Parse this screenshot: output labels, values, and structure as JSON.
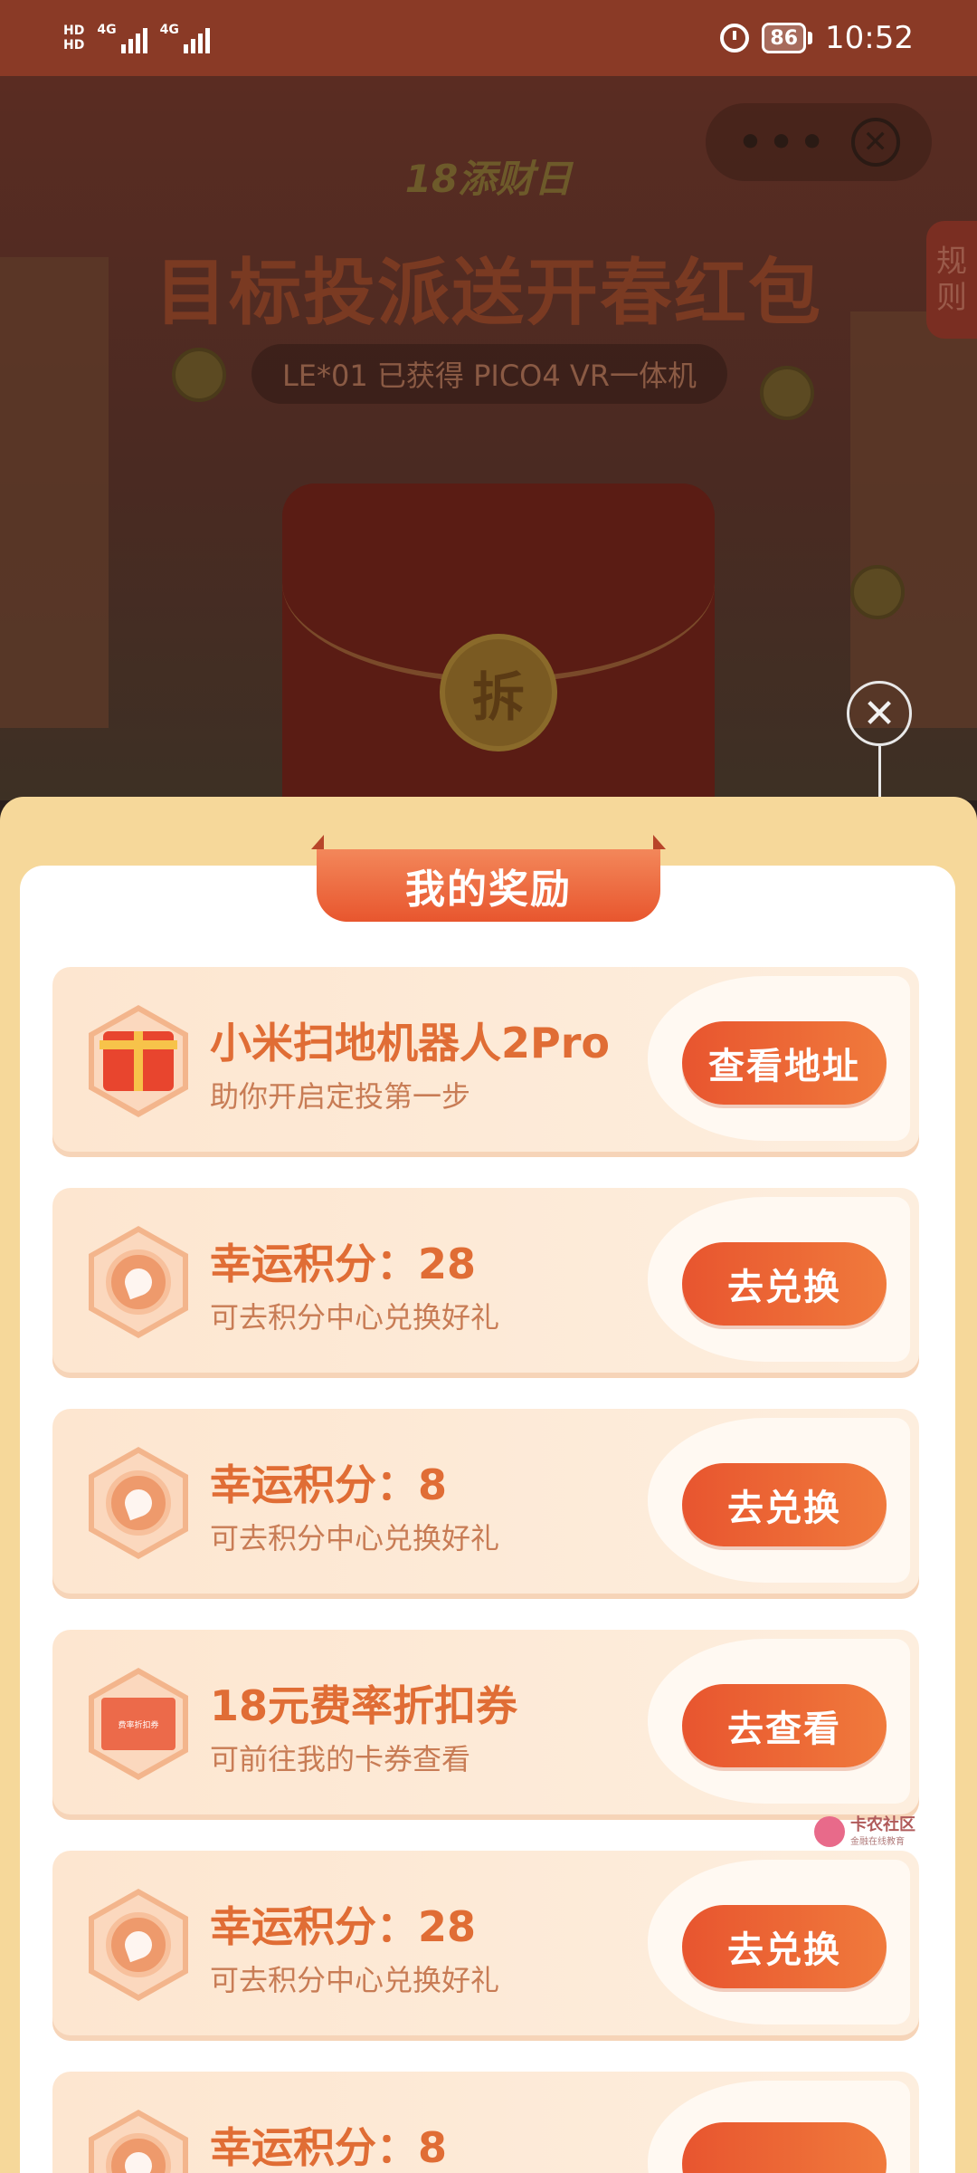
{
  "status_bar": {
    "hd_top": "HD",
    "hd_bottom": "HD",
    "signal1": "4G",
    "signal2": "4G",
    "battery": "86",
    "time": "10:52"
  },
  "background_page": {
    "logo_text": "18添财日",
    "title": "目标投派送开春红包",
    "subtitle": "LE*01 已获得 PICO4 VR一体机",
    "rules_tab": [
      "规",
      "则"
    ],
    "seal_char": "拆",
    "more_label": "•••",
    "close_symbol": "✕"
  },
  "popup": {
    "close_symbol": "✕",
    "title": "我的奖励",
    "rewards": [
      {
        "icon": "gift-icon",
        "name": "小米扫地机器人2Pro",
        "desc": "助你开启定投第一步",
        "button": "查看地址"
      },
      {
        "icon": "points-coin-icon",
        "name": "幸运积分：28",
        "desc": "可去积分中心兑换好礼",
        "button": "去兑换"
      },
      {
        "icon": "points-coin-icon",
        "name": "幸运积分：8",
        "desc": "可去积分中心兑换好礼",
        "button": "去兑换"
      },
      {
        "icon": "coupon-icon",
        "name": "18元费率折扣券",
        "desc": "可前往我的卡券查看",
        "button": "去查看",
        "icon_text": "费率折扣券"
      },
      {
        "icon": "points-coin-icon",
        "name": "幸运积分：28",
        "desc": "可去积分中心兑换好礼",
        "button": "去兑换"
      },
      {
        "icon": "points-coin-icon",
        "name": "幸运积分：8",
        "desc": "",
        "button": ""
      }
    ]
  },
  "watermark": {
    "title": "卡农社区",
    "sub": "金融在线教育"
  },
  "colors": {
    "accent": "#e8552f",
    "reward_text": "#e06d35",
    "sheet_bg": "#f6d89a",
    "status_bar": "#8a3a26"
  }
}
